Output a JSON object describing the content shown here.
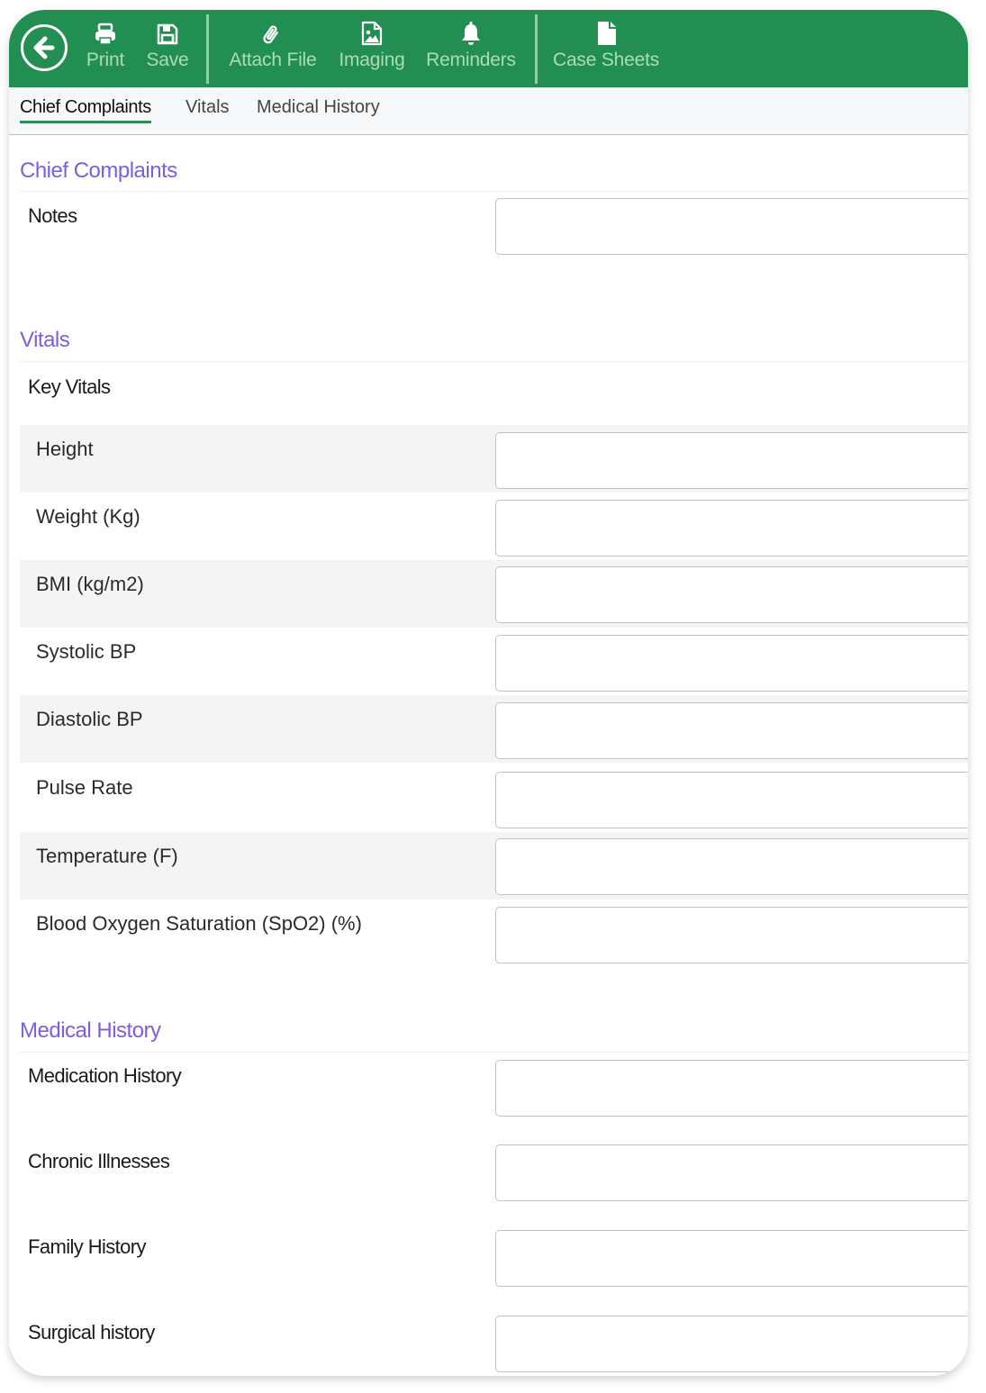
{
  "toolbar": {
    "back_icon": "circle-arrow-left-icon",
    "buttons": [
      {
        "label": "Print",
        "icon": "printer-icon"
      },
      {
        "label": "Save",
        "icon": "floppy-disk-icon"
      },
      {
        "label": "Attach File",
        "icon": "paperclip-icon"
      },
      {
        "label": "Imaging",
        "icon": "image-file-icon"
      },
      {
        "label": "Reminders",
        "icon": "bell-icon"
      },
      {
        "label": "Case Sheets",
        "icon": "file-icon"
      }
    ],
    "colors": {
      "background": "#238e52",
      "label": "#a9dcb9"
    }
  },
  "tabs": {
    "items": [
      {
        "label": "Chief Complaints",
        "active": true
      },
      {
        "label": "Vitals",
        "active": false
      },
      {
        "label": "Medical History",
        "active": false
      }
    ]
  },
  "chief_complaints": {
    "title": "Chief Complaints",
    "fields": [
      {
        "label": "Notes",
        "value": ""
      }
    ]
  },
  "vitals": {
    "title": "Vitals",
    "subtitle": "Key Vitals",
    "fields": [
      {
        "label": "Height",
        "value": ""
      },
      {
        "label": "Weight (Kg)",
        "value": ""
      },
      {
        "label": "BMI (kg/m2)",
        "value": ""
      },
      {
        "label": "Systolic BP",
        "value": ""
      },
      {
        "label": "Diastolic BP",
        "value": ""
      },
      {
        "label": "Pulse Rate",
        "value": ""
      },
      {
        "label": "Temperature (F)",
        "value": ""
      },
      {
        "label": "Blood Oxygen Saturation (SpO2) (%)",
        "value": ""
      }
    ]
  },
  "medical_history": {
    "title": "Medical History",
    "fields": [
      {
        "label": "Medication History",
        "value": ""
      },
      {
        "label": "Chronic Illnesses",
        "value": ""
      },
      {
        "label": "Family History",
        "value": ""
      },
      {
        "label": "Surgical history",
        "value": ""
      }
    ]
  },
  "theme": {
    "section_title_color": "#7b5fe0",
    "active_tab_underline": "#2e8b57",
    "shaded_row": "#f4f4f4"
  }
}
